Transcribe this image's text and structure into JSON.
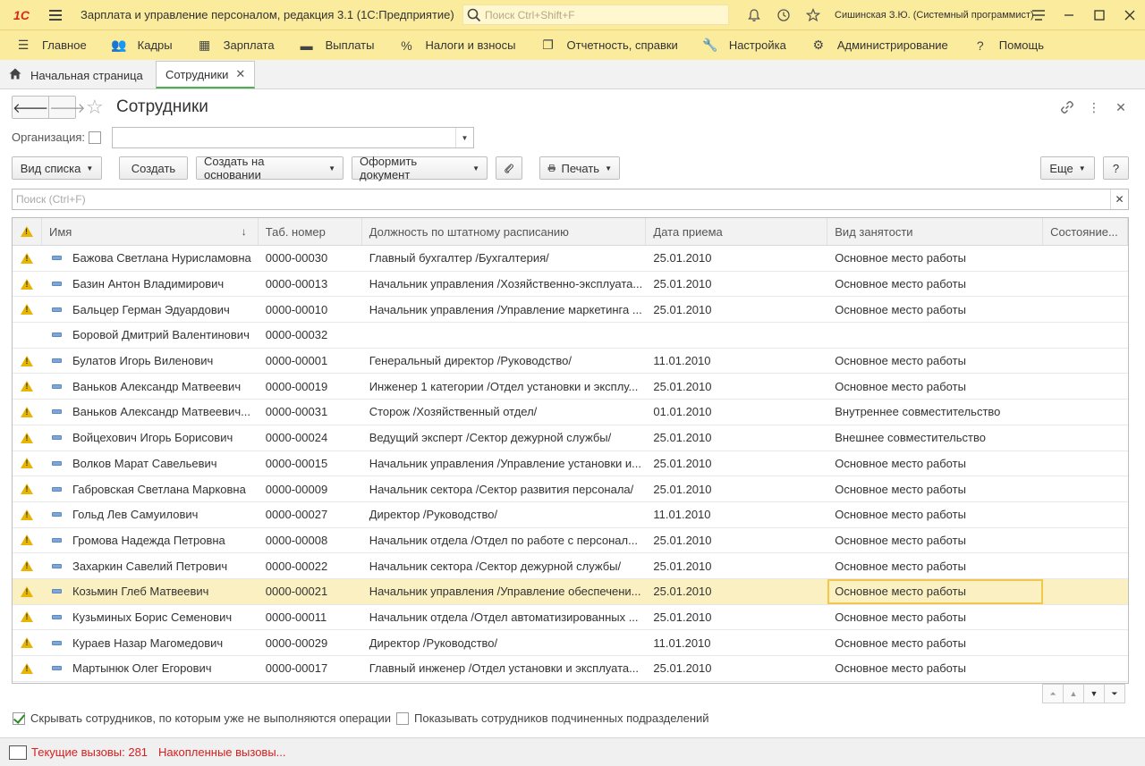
{
  "titlebar": {
    "logo": "1С",
    "title": "Зарплата и управление персоналом, редакция 3.1  (1С:Предприятие)",
    "search_placeholder": "Поиск Ctrl+Shift+F",
    "user": "Сишинская З.Ю. (Системный программист)"
  },
  "main_menu": [
    {
      "label": "Главное",
      "icon": "hamburger-icon"
    },
    {
      "label": "Кадры",
      "icon": "people-icon"
    },
    {
      "label": "Зарплата",
      "icon": "calculator-icon"
    },
    {
      "label": "Выплаты",
      "icon": "wallet-icon"
    },
    {
      "label": "Налоги и взносы",
      "icon": "percent-icon"
    },
    {
      "label": "Отчетность, справки",
      "icon": "reports-icon"
    },
    {
      "label": "Настройка",
      "icon": "wrench-icon"
    },
    {
      "label": "Администрирование",
      "icon": "gear-icon"
    },
    {
      "label": "Помощь",
      "icon": "question-icon"
    }
  ],
  "tabs": {
    "home": "Начальная страница",
    "active": "Сотрудники"
  },
  "form": {
    "title": "Сотрудники",
    "org_label": "Организация:",
    "org_value": ""
  },
  "toolbar": {
    "view_list": "Вид списка",
    "create": "Создать",
    "create_based": "Создать на основании",
    "make_document": "Оформить документ",
    "print": "Печать",
    "more": "Еще",
    "help": "?"
  },
  "search": {
    "placeholder": "Поиск (Ctrl+F)"
  },
  "table": {
    "columns": [
      "Имя",
      "Таб. номер",
      "Должность по штатному расписанию",
      "Дата приема",
      "Вид занятости",
      "Состояние..."
    ],
    "rows": [
      {
        "warn": true,
        "name": "Бажова Светлана Нурисламовна",
        "num": "0000-00030",
        "pos": "Главный бухгалтер /Бухгалтерия/",
        "date": "25.01.2010",
        "emp": "Основное место работы",
        "state": ""
      },
      {
        "warn": true,
        "name": "Базин Антон Владимирович",
        "num": "0000-00013",
        "pos": "Начальник управления /Хозяйственно-эксплуата...",
        "date": "25.01.2010",
        "emp": "Основное место работы",
        "state": ""
      },
      {
        "warn": true,
        "name": "Бальцер Герман Эдуардович",
        "num": "0000-00010",
        "pos": "Начальник управления /Управление маркетинга ...",
        "date": "25.01.2010",
        "emp": "Основное место работы",
        "state": ""
      },
      {
        "warn": false,
        "name": "Боровой Дмитрий Валентинович",
        "num": "0000-00032",
        "pos": "",
        "date": "",
        "emp": "",
        "state": ""
      },
      {
        "warn": true,
        "name": "Булатов Игорь Виленович",
        "num": "0000-00001",
        "pos": "Генеральный директор /Руководство/",
        "date": "11.01.2010",
        "emp": "Основное место работы",
        "state": ""
      },
      {
        "warn": true,
        "name": "Ваньков Александр Матвеевич",
        "num": "0000-00019",
        "pos": "Инженер 1 категории /Отдел установки и эксплу...",
        "date": "25.01.2010",
        "emp": "Основное место работы",
        "state": ""
      },
      {
        "warn": true,
        "name": "Ваньков Александр Матвеевич...",
        "num": "0000-00031",
        "pos": "Сторож /Хозяйственный отдел/",
        "date": "01.01.2010",
        "emp": "Внутреннее совместительство",
        "state": ""
      },
      {
        "warn": true,
        "name": "Войцехович Игорь Борисович",
        "num": "0000-00024",
        "pos": "Ведущий эксперт /Сектор дежурной службы/",
        "date": "25.01.2010",
        "emp": "Внешнее совместительство",
        "state": ""
      },
      {
        "warn": true,
        "name": "Волков Марат Савельевич",
        "num": "0000-00015",
        "pos": "Начальник управления /Управление установки и...",
        "date": "25.01.2010",
        "emp": "Основное место работы",
        "state": ""
      },
      {
        "warn": true,
        "name": "Габровская Светлана Марковна",
        "num": "0000-00009",
        "pos": "Начальник сектора /Сектор развития персонала/",
        "date": "25.01.2010",
        "emp": "Основное место работы",
        "state": ""
      },
      {
        "warn": true,
        "name": "Гольд Лев Самуилович",
        "num": "0000-00027",
        "pos": "Директор /Руководство/",
        "date": "11.01.2010",
        "emp": "Основное место работы",
        "state": ""
      },
      {
        "warn": true,
        "name": "Громова Надежда Петровна",
        "num": "0000-00008",
        "pos": "Начальник отдела /Отдел по работе с персонал...",
        "date": "25.01.2010",
        "emp": "Основное место работы",
        "state": ""
      },
      {
        "warn": true,
        "name": "Захаркин Савелий Петрович",
        "num": "0000-00022",
        "pos": "Начальник сектора /Сектор дежурной службы/",
        "date": "25.01.2010",
        "emp": "Основное место работы",
        "state": ""
      },
      {
        "warn": true,
        "name": "Козьмин Глеб Матвеевич",
        "num": "0000-00021",
        "pos": "Начальник управления /Управление обеспечени...",
        "date": "25.01.2010",
        "emp": "Основное место работы",
        "state": "",
        "selected": true
      },
      {
        "warn": true,
        "name": "Кузьминых Борис Семенович",
        "num": "0000-00011",
        "pos": "Начальник отдела /Отдел автоматизированных ...",
        "date": "25.01.2010",
        "emp": "Основное место работы",
        "state": ""
      },
      {
        "warn": true,
        "name": "Кураев Назар Магомедович",
        "num": "0000-00029",
        "pos": "Директор /Руководство/",
        "date": "11.01.2010",
        "emp": "Основное место работы",
        "state": ""
      },
      {
        "warn": true,
        "name": "Мартынюк Олег Егорович",
        "num": "0000-00017",
        "pos": "Главный инженер /Отдел установки и эксплуата...",
        "date": "25.01.2010",
        "emp": "Основное место работы",
        "state": ""
      }
    ]
  },
  "bottom": {
    "hide_label": "Скрывать сотрудников, по которым уже не выполняются операции",
    "hide_checked": true,
    "show_sub_label": "Показывать сотрудников подчиненных подразделений",
    "show_sub_checked": false
  },
  "status": {
    "current_calls": "Текущие вызовы: 281",
    "accum_calls": "Накопленные вызовы..."
  },
  "colors": {
    "accent_bar": "#fbeb9c",
    "selected_row": "#fbf0c1",
    "status_text": "#d62020"
  }
}
